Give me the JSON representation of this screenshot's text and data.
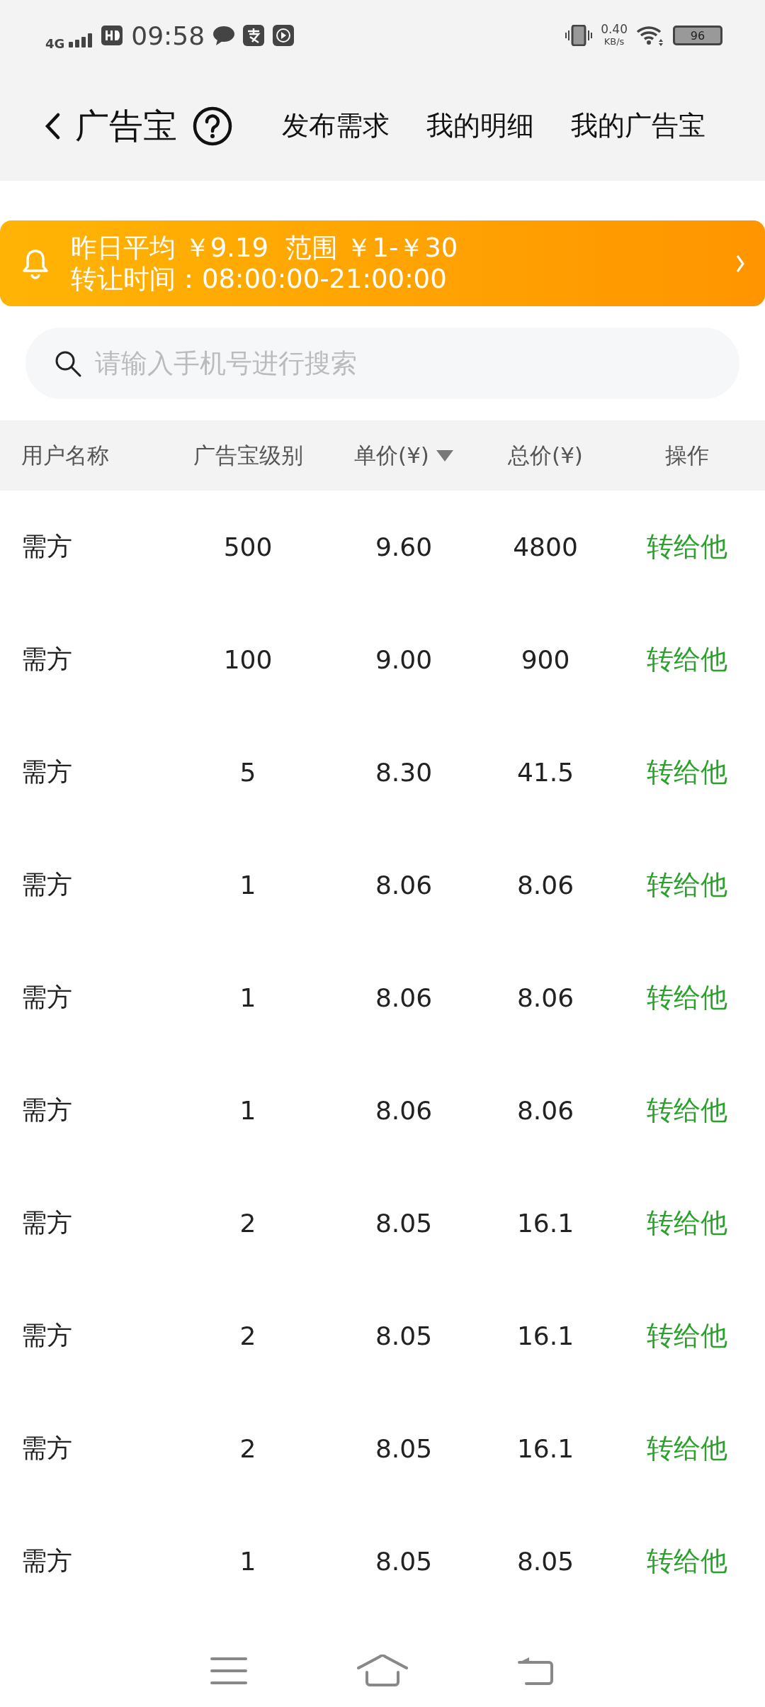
{
  "status_bar": {
    "network": "4G",
    "time": "09:58",
    "speed": "0.40",
    "speed_unit": "KB/s",
    "battery": "96"
  },
  "header": {
    "title": "广告宝",
    "links": [
      "发布需求",
      "我的明细",
      "我的广告宝"
    ]
  },
  "banner": {
    "line_1": "昨日平均 ￥9.19  范围 ￥1-￥30",
    "line_2": "转让时间：08:00:00-21:00:00"
  },
  "search": {
    "placeholder": "请输入手机号进行搜索"
  },
  "table": {
    "columns": [
      {
        "label": "用户名称",
        "sorted": false
      },
      {
        "label": "广告宝级别",
        "sorted": false
      },
      {
        "label": "单价(¥)",
        "sorted": true
      },
      {
        "label": "总价(¥)",
        "sorted": false
      },
      {
        "label": "操作",
        "sorted": false
      }
    ],
    "rows": [
      {
        "user": "需方",
        "level": "500",
        "price": "9.60",
        "total": "4800",
        "action": "转给他"
      },
      {
        "user": "需方",
        "level": "100",
        "price": "9.00",
        "total": "900",
        "action": "转给他"
      },
      {
        "user": "需方",
        "level": "5",
        "price": "8.30",
        "total": "41.5",
        "action": "转给他"
      },
      {
        "user": "需方",
        "level": "1",
        "price": "8.06",
        "total": "8.06",
        "action": "转给他"
      },
      {
        "user": "需方",
        "level": "1",
        "price": "8.06",
        "total": "8.06",
        "action": "转给他"
      },
      {
        "user": "需方",
        "level": "1",
        "price": "8.06",
        "total": "8.06",
        "action": "转给他"
      },
      {
        "user": "需方",
        "level": "2",
        "price": "8.05",
        "total": "16.1",
        "action": "转给他"
      },
      {
        "user": "需方",
        "level": "2",
        "price": "8.05",
        "total": "16.1",
        "action": "转给他"
      },
      {
        "user": "需方",
        "level": "2",
        "price": "8.05",
        "total": "16.1",
        "action": "转给他"
      },
      {
        "user": "需方",
        "level": "1",
        "price": "8.05",
        "total": "8.05",
        "action": "转给他"
      }
    ]
  }
}
